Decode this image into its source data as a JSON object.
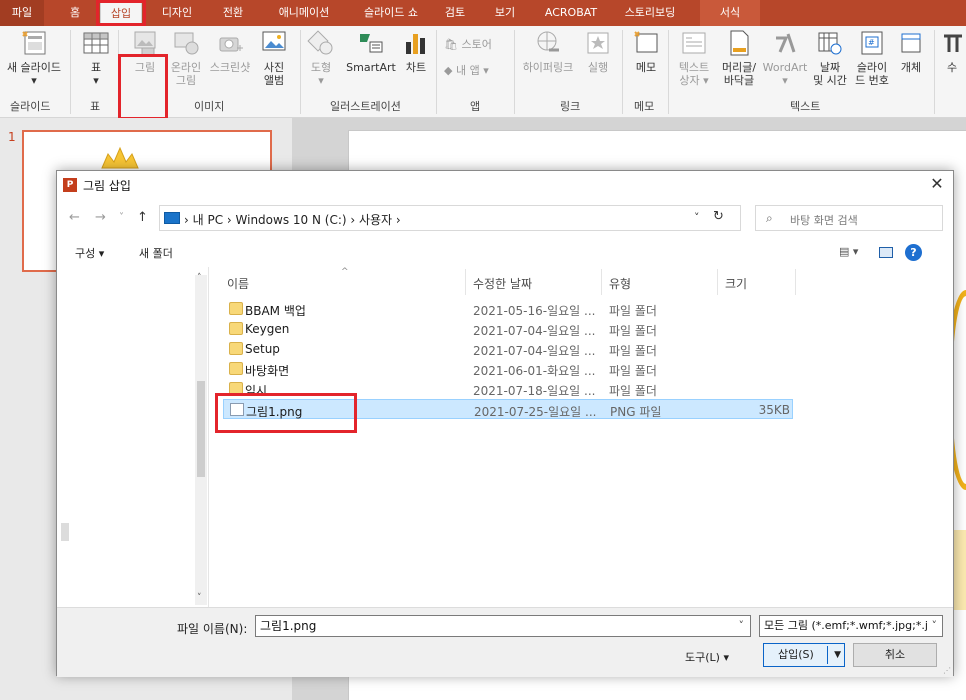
{
  "ribbon_tabs": [
    "파일",
    "홈",
    "삽입",
    "디자인",
    "전환",
    "애니메이션",
    "슬라이드 쇼",
    "검토",
    "보기",
    "ACROBAT",
    "스토리보딩",
    "서식"
  ],
  "ribbon": {
    "new_slide": "새 슬라이드",
    "table": "표",
    "picture": "그림",
    "online_picture": [
      "온라인",
      "그림"
    ],
    "screenshot": "스크린샷",
    "photo_album": [
      "사진",
      "앨범"
    ],
    "shapes": "도형",
    "smartart": "SmartArt",
    "chart": "차트",
    "store": "스토어",
    "my_apps": "내 앱",
    "hyperlink": "하이퍼링크",
    "action": "실행",
    "memo": "메모",
    "textbox": [
      "텍스트",
      "상자"
    ],
    "header_footer": [
      "머리글/",
      "바닥글"
    ],
    "wordart": "WordArt",
    "date_time": [
      "날짜",
      "및 시간"
    ],
    "slide_number": [
      "슬라이",
      "드 번호"
    ],
    "object": "개체",
    "equation": "수",
    "groups": {
      "slides": "슬라이드",
      "table": "표",
      "images": "이미지",
      "illustrations": "일러스트레이션",
      "apps": "앱",
      "links": "링크",
      "memo": "메모",
      "text": "텍스트"
    }
  },
  "slide_panel": {
    "slide_number": "1"
  },
  "dialog": {
    "title": "그림 삽입",
    "app_icon": "P",
    "close": "✕",
    "nav": {
      "back": "←",
      "forward": "→",
      "dropdown": "˅",
      "up": "↑"
    },
    "breadcrumb": "›  내 PC  ›  Windows 10 N (C:)  ›  사용자  ›",
    "refresh": "↻",
    "search_placeholder": "바탕 화면 검색",
    "organize": "구성 ▾",
    "new_folder": "새 폴더",
    "view_icon": "▤ ▾",
    "help": "?",
    "columns": [
      "이름",
      "수정한 날짜",
      "유형",
      "크기"
    ],
    "files": [
      {
        "name": "BBAM 백업",
        "date": "2021-05-16-일요일 ...",
        "type": "파일 폴더",
        "size": "",
        "kind": "folder"
      },
      {
        "name": "Keygen",
        "date": "2021-07-04-일요일 ...",
        "type": "파일 폴더",
        "size": "",
        "kind": "folder"
      },
      {
        "name": "Setup",
        "date": "2021-07-04-일요일 ...",
        "type": "파일 폴더",
        "size": "",
        "kind": "folder"
      },
      {
        "name": "바탕화면",
        "date": "2021-06-01-화요일 ...",
        "type": "파일 폴더",
        "size": "",
        "kind": "folder"
      },
      {
        "name": "임시",
        "date": "2021-07-18-일요일 ...",
        "type": "파일 폴더",
        "size": "",
        "kind": "folder"
      },
      {
        "name": "그림1.png",
        "date": "2021-07-25-일요일 ...",
        "type": "PNG 파일",
        "size": "35KB",
        "kind": "png",
        "selected": true
      }
    ],
    "filename_label": "파일 이름(N):",
    "filename_value": "그림1.png",
    "filter_value": "모든 그림 (*.emf;*.wmf;*.jpg;*.j",
    "tools": "도구(L)  ▾",
    "insert": "삽입(S)",
    "cancel": "취소"
  },
  "colors": {
    "accent": "#b7472a",
    "highlight": "#e3242b",
    "selection": "#cce8ff"
  }
}
